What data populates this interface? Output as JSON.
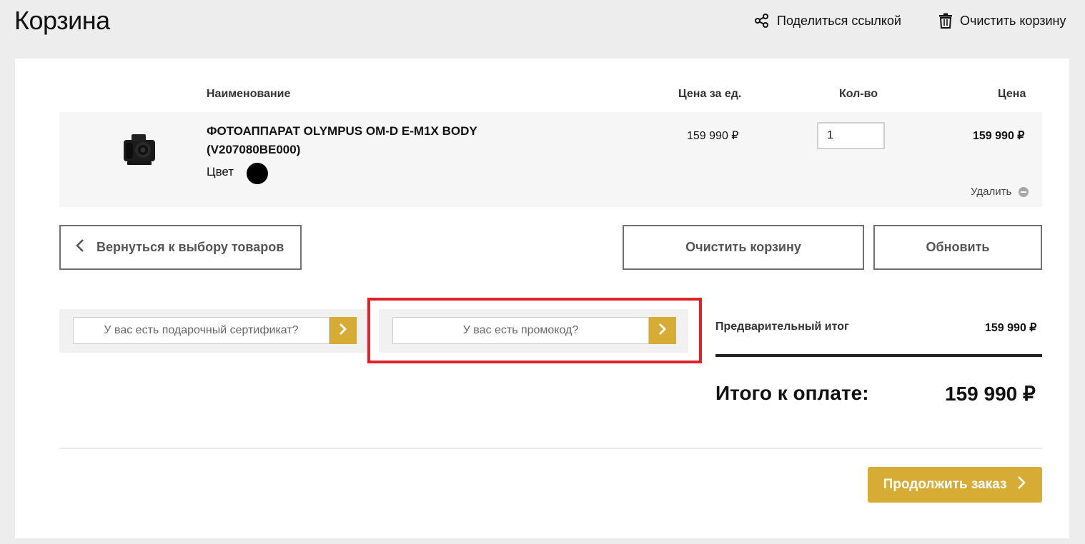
{
  "page": {
    "title": "Корзина"
  },
  "header_actions": {
    "share_label": "Поделиться ссылкой",
    "clear_label": "Очистить корзину"
  },
  "table": {
    "headers": {
      "name": "Наименование",
      "unit_price": "Цена за ед.",
      "qty": "Кол-во",
      "price": "Цена"
    }
  },
  "item": {
    "name_line1": "ФОТОАППАРАТ OLYMPUS OM-D E-M1X BODY",
    "name_line2": "(V207080BE000)",
    "color_label": "Цвет",
    "color_value": "#000000",
    "unit_price": "159 990 ₽",
    "qty": "1",
    "total": "159 990 ₽",
    "remove_label": "Удалить"
  },
  "actions": {
    "back_label": "Вернуться к выбору товаров",
    "clear_label": "Очистить корзину",
    "update_label": "Обновить"
  },
  "codes": {
    "gift_placeholder": "У вас есть подарочный сертификат?",
    "promo_placeholder": "У вас есть промокод?"
  },
  "summary": {
    "subtotal_label": "Предварительный итог",
    "subtotal_value": "159 990 ₽",
    "total_label": "Итого к оплате:",
    "total_value": "159 990 ₽"
  },
  "checkout": {
    "continue_label": "Продолжить заказ"
  },
  "colors": {
    "accent": "#d6ac35",
    "highlight": "#e0202a",
    "page_bg": "#ededed"
  },
  "icons": {
    "share": "share-icon",
    "trash": "trash-icon",
    "chevron_left": "chevron-left-icon",
    "chevron_right": "chevron-right-icon",
    "remove": "minus-circle-icon"
  }
}
